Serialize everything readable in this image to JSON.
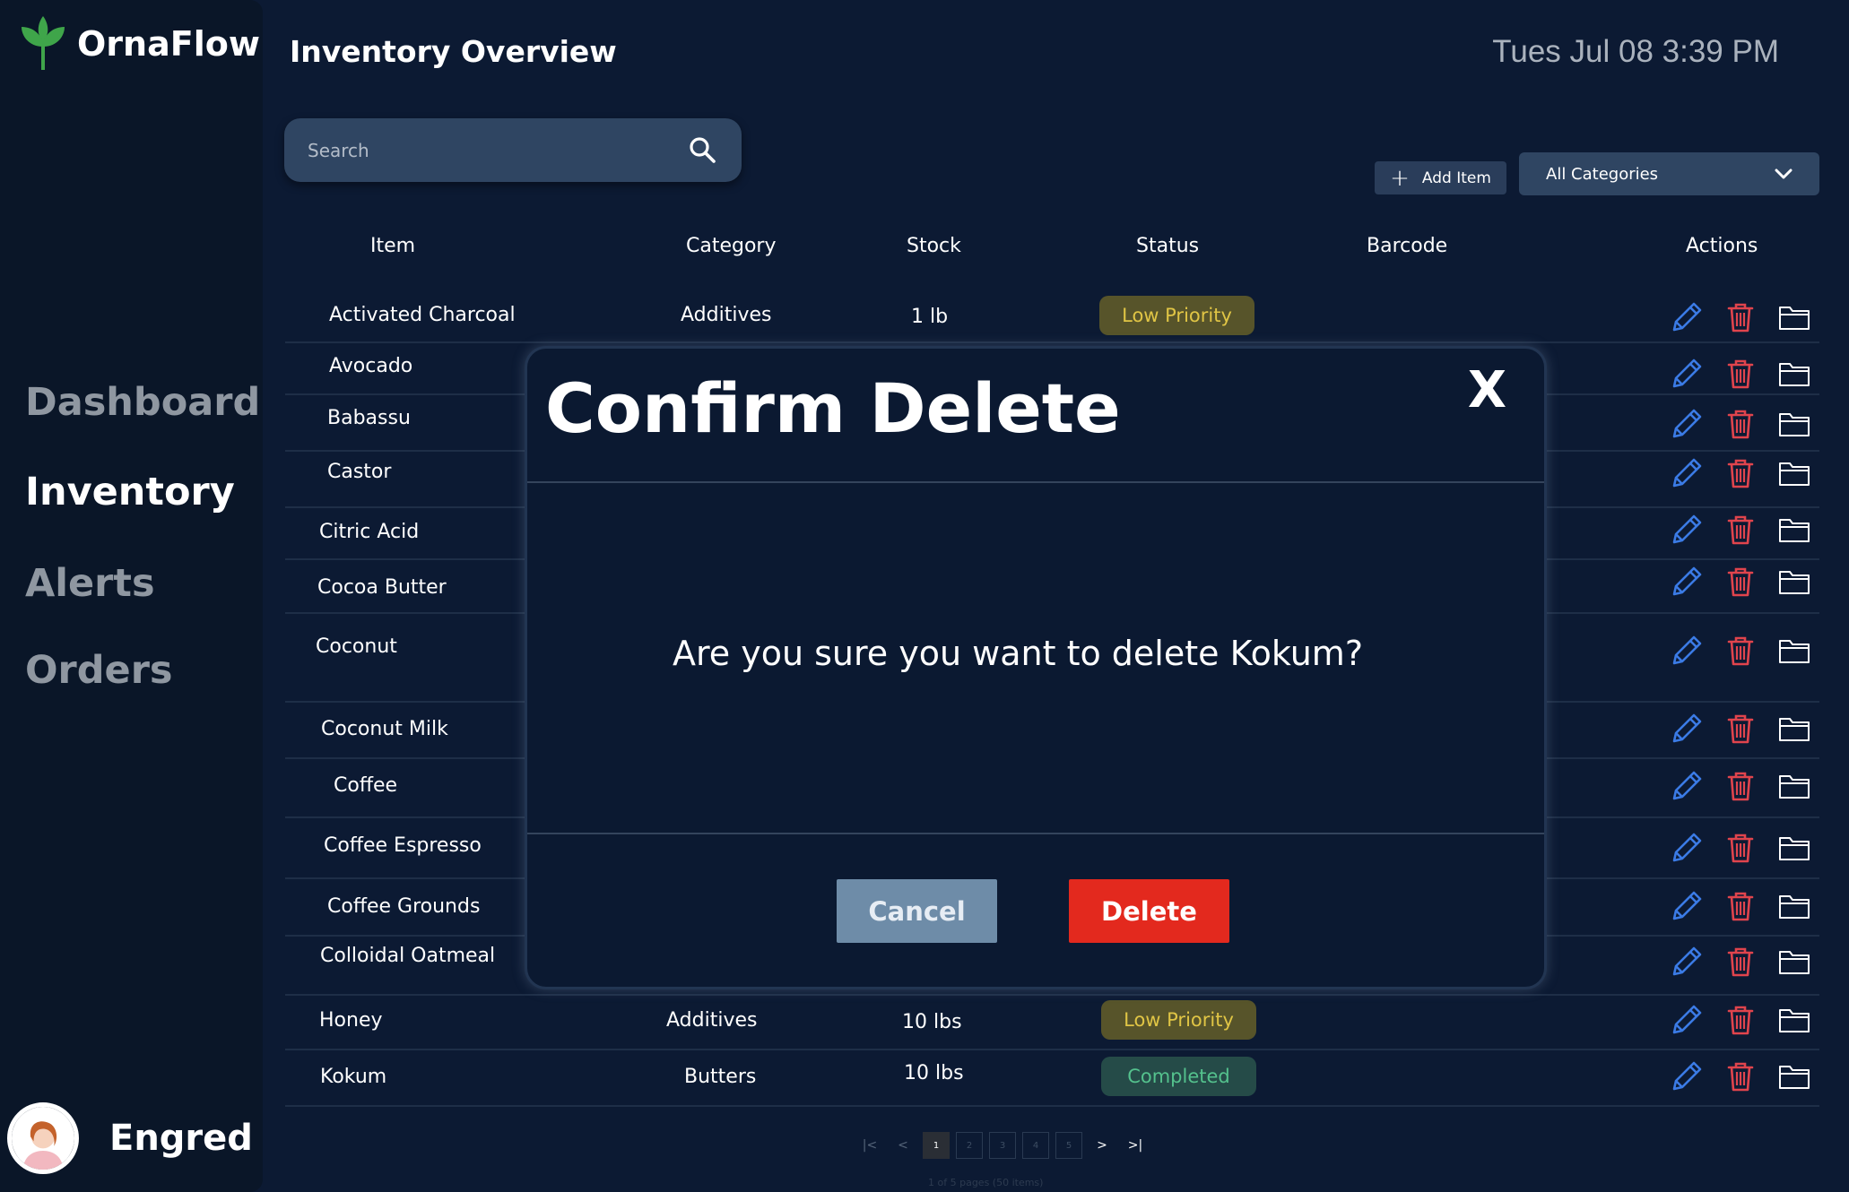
{
  "app": {
    "name": "OrnaFlow"
  },
  "nav": {
    "items": [
      {
        "label": "Dashboard"
      },
      {
        "label": "Inventory"
      },
      {
        "label": "Alerts"
      },
      {
        "label": "Orders"
      }
    ],
    "active": "Inventory"
  },
  "user": {
    "name": "Engred"
  },
  "header": {
    "title": "Inventory Overview",
    "datetime": "Tues Jul 08 3:39 PM"
  },
  "search": {
    "placeholder": "Search"
  },
  "toolbar": {
    "add_label": "Add Item",
    "category_value": "All Categories"
  },
  "table": {
    "columns": [
      "Item",
      "Category",
      "Stock",
      "Status",
      "Barcode",
      "Actions"
    ],
    "rows": [
      {
        "item": "Activated Charcoal",
        "category": "Additives",
        "stock": "1 lb",
        "status": "Low Priority",
        "barcode": ""
      },
      {
        "item": "Avocado",
        "category": "",
        "stock": "",
        "status": "",
        "barcode": ""
      },
      {
        "item": "Babassu",
        "category": "",
        "stock": "",
        "status": "",
        "barcode": ""
      },
      {
        "item": "Castor",
        "category": "",
        "stock": "",
        "status": "",
        "barcode": ""
      },
      {
        "item": "Citric Acid",
        "category": "",
        "stock": "",
        "status": "",
        "barcode": ""
      },
      {
        "item": "Cocoa Butter",
        "category": "",
        "stock": "",
        "status": "",
        "barcode": ""
      },
      {
        "item": "Coconut",
        "category": "",
        "stock": "",
        "status": "",
        "barcode": ""
      },
      {
        "item": "Coconut Milk",
        "category": "",
        "stock": "",
        "status": "",
        "barcode": ""
      },
      {
        "item": "Coffee",
        "category": "",
        "stock": "",
        "status": "",
        "barcode": ""
      },
      {
        "item": "Coffee Espresso",
        "category": "",
        "stock": "",
        "status": "",
        "barcode": ""
      },
      {
        "item": "Coffee Grounds",
        "category": "",
        "stock": "",
        "status": "",
        "barcode": ""
      },
      {
        "item": "Colloidal Oatmeal",
        "category": "",
        "stock": "",
        "status": "",
        "barcode": ""
      },
      {
        "item": "Honey",
        "category": "Additives",
        "stock": "10 lbs",
        "status": "Low Priority",
        "barcode": ""
      },
      {
        "item": "Kokum",
        "category": "Butters",
        "stock": "10 lbs",
        "status": "Completed",
        "barcode": ""
      }
    ],
    "actions": {
      "edit": "pencil-icon",
      "delete": "trash-icon",
      "details": "folder-icon"
    },
    "status_colors": {
      "Low Priority": "#e0c545",
      "Completed": "#54c18d"
    }
  },
  "pagination": {
    "pages": [
      "1",
      "2",
      "3",
      "4",
      "5"
    ],
    "current": "1",
    "info": "1 of 5 pages (50 items)",
    "first": "|<",
    "prev": "<",
    "next": ">",
    "last": ">|"
  },
  "modal": {
    "title": "Confirm Delete",
    "close": "X",
    "message": "Are you sure you want to delete Kokum?",
    "cancel_label": "Cancel",
    "delete_label": "Delete",
    "delete_color": "#e3291e",
    "cancel_color": "#6e8ca8"
  },
  "colors": {
    "background": "#0c1a33",
    "sidebar": "#0a1628",
    "accent_green": "#3fa54a",
    "icon_blue": "#3b7be6",
    "icon_red": "#e0444d"
  }
}
